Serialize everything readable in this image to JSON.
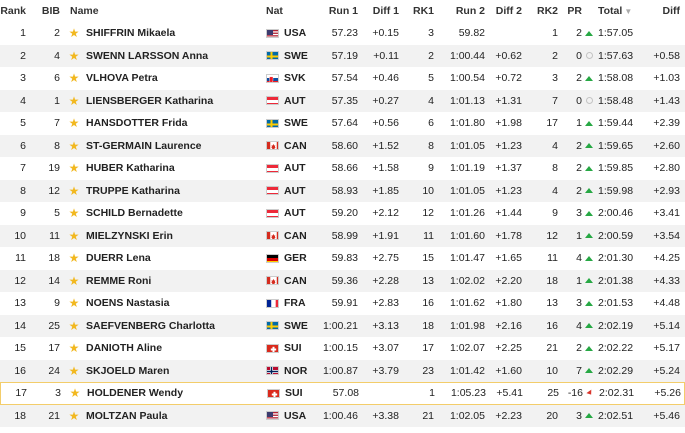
{
  "headers": {
    "rank": "Rank",
    "bib": "BIB",
    "name": "Name",
    "nat": "Nat",
    "run1": "Run 1",
    "diff1": "Diff 1",
    "rk1": "RK1",
    "run2": "Run 2",
    "diff2": "Diff 2",
    "rk2": "RK2",
    "pr": "PR",
    "total": "Total",
    "diff": "Diff"
  },
  "colors": {
    "star": "#f2b81f",
    "arrow_up": "#27a844",
    "arrow_down": "#d9342b",
    "highlight_border": "#f3cd6a"
  },
  "rows": [
    {
      "rank": "1",
      "bib": "2",
      "name": "SHIFFRIN Mikaela",
      "nat": "USA",
      "run1": "57.23",
      "diff1": "+0.15",
      "rk1": "3",
      "run2": "59.82",
      "diff2": "",
      "rk2": "1",
      "pr": "2",
      "trend": "up",
      "total": "1:57.05",
      "diff": ""
    },
    {
      "rank": "2",
      "bib": "4",
      "name": "SWENN LARSSON Anna",
      "nat": "SWE",
      "run1": "57.19",
      "diff1": "+0.11",
      "rk1": "2",
      "run2": "1:00.44",
      "diff2": "+0.62",
      "rk2": "2",
      "pr": "0",
      "trend": "same",
      "total": "1:57.63",
      "diff": "+0.58"
    },
    {
      "rank": "3",
      "bib": "6",
      "name": "VLHOVA Petra",
      "nat": "SVK",
      "run1": "57.54",
      "diff1": "+0.46",
      "rk1": "5",
      "run2": "1:00.54",
      "diff2": "+0.72",
      "rk2": "3",
      "pr": "2",
      "trend": "up",
      "total": "1:58.08",
      "diff": "+1.03"
    },
    {
      "rank": "4",
      "bib": "1",
      "name": "LIENSBERGER Katharina",
      "nat": "AUT",
      "run1": "57.35",
      "diff1": "+0.27",
      "rk1": "4",
      "run2": "1:01.13",
      "diff2": "+1.31",
      "rk2": "7",
      "pr": "0",
      "trend": "same",
      "total": "1:58.48",
      "diff": "+1.43"
    },
    {
      "rank": "5",
      "bib": "7",
      "name": "HANSDOTTER Frida",
      "nat": "SWE",
      "run1": "57.64",
      "diff1": "+0.56",
      "rk1": "6",
      "run2": "1:01.80",
      "diff2": "+1.98",
      "rk2": "17",
      "pr": "1",
      "trend": "up",
      "total": "1:59.44",
      "diff": "+2.39"
    },
    {
      "rank": "6",
      "bib": "8",
      "name": "ST-GERMAIN Laurence",
      "nat": "CAN",
      "run1": "58.60",
      "diff1": "+1.52",
      "rk1": "8",
      "run2": "1:01.05",
      "diff2": "+1.23",
      "rk2": "4",
      "pr": "2",
      "trend": "up",
      "total": "1:59.65",
      "diff": "+2.60"
    },
    {
      "rank": "7",
      "bib": "19",
      "name": "HUBER Katharina",
      "nat": "AUT",
      "run1": "58.66",
      "diff1": "+1.58",
      "rk1": "9",
      "run2": "1:01.19",
      "diff2": "+1.37",
      "rk2": "8",
      "pr": "2",
      "trend": "up",
      "total": "1:59.85",
      "diff": "+2.80"
    },
    {
      "rank": "8",
      "bib": "12",
      "name": "TRUPPE Katharina",
      "nat": "AUT",
      "run1": "58.93",
      "diff1": "+1.85",
      "rk1": "10",
      "run2": "1:01.05",
      "diff2": "+1.23",
      "rk2": "4",
      "pr": "2",
      "trend": "up",
      "total": "1:59.98",
      "diff": "+2.93"
    },
    {
      "rank": "9",
      "bib": "5",
      "name": "SCHILD Bernadette",
      "nat": "AUT",
      "run1": "59.20",
      "diff1": "+2.12",
      "rk1": "12",
      "run2": "1:01.26",
      "diff2": "+1.44",
      "rk2": "9",
      "pr": "3",
      "trend": "up",
      "total": "2:00.46",
      "diff": "+3.41"
    },
    {
      "rank": "10",
      "bib": "11",
      "name": "MIELZYNSKI Erin",
      "nat": "CAN",
      "run1": "58.99",
      "diff1": "+1.91",
      "rk1": "11",
      "run2": "1:01.60",
      "diff2": "+1.78",
      "rk2": "12",
      "pr": "1",
      "trend": "up",
      "total": "2:00.59",
      "diff": "+3.54"
    },
    {
      "rank": "11",
      "bib": "18",
      "name": "DUERR Lena",
      "nat": "GER",
      "run1": "59.83",
      "diff1": "+2.75",
      "rk1": "15",
      "run2": "1:01.47",
      "diff2": "+1.65",
      "rk2": "11",
      "pr": "4",
      "trend": "up",
      "total": "2:01.30",
      "diff": "+4.25"
    },
    {
      "rank": "12",
      "bib": "14",
      "name": "REMME Roni",
      "nat": "CAN",
      "run1": "59.36",
      "diff1": "+2.28",
      "rk1": "13",
      "run2": "1:02.02",
      "diff2": "+2.20",
      "rk2": "18",
      "pr": "1",
      "trend": "up",
      "total": "2:01.38",
      "diff": "+4.33"
    },
    {
      "rank": "13",
      "bib": "9",
      "name": "NOENS Nastasia",
      "nat": "FRA",
      "run1": "59.91",
      "diff1": "+2.83",
      "rk1": "16",
      "run2": "1:01.62",
      "diff2": "+1.80",
      "rk2": "13",
      "pr": "3",
      "trend": "up",
      "total": "2:01.53",
      "diff": "+4.48"
    },
    {
      "rank": "14",
      "bib": "25",
      "name": "SAEFVENBERG Charlotta",
      "nat": "SWE",
      "run1": "1:00.21",
      "diff1": "+3.13",
      "rk1": "18",
      "run2": "1:01.98",
      "diff2": "+2.16",
      "rk2": "16",
      "pr": "4",
      "trend": "up",
      "total": "2:02.19",
      "diff": "+5.14"
    },
    {
      "rank": "15",
      "bib": "17",
      "name": "DANIOTH Aline",
      "nat": "SUI",
      "run1": "1:00.15",
      "diff1": "+3.07",
      "rk1": "17",
      "run2": "1:02.07",
      "diff2": "+2.25",
      "rk2": "21",
      "pr": "2",
      "trend": "up",
      "total": "2:02.22",
      "diff": "+5.17"
    },
    {
      "rank": "16",
      "bib": "24",
      "name": "SKJOELD Maren",
      "nat": "NOR",
      "run1": "1:00.87",
      "diff1": "+3.79",
      "rk1": "23",
      "run2": "1:01.42",
      "diff2": "+1.60",
      "rk2": "10",
      "pr": "7",
      "trend": "up",
      "total": "2:02.29",
      "diff": "+5.24"
    },
    {
      "rank": "17",
      "bib": "3",
      "name": "HOLDENER Wendy",
      "nat": "SUI",
      "run1": "57.08",
      "diff1": "",
      "rk1": "1",
      "run2": "1:05.23",
      "diff2": "+5.41",
      "rk2": "25",
      "pr": "-16",
      "trend": "down",
      "total": "2:02.31",
      "diff": "+5.26"
    },
    {
      "rank": "18",
      "bib": "21",
      "name": "MOLTZAN Paula",
      "nat": "USA",
      "run1": "1:00.46",
      "diff1": "+3.38",
      "rk1": "21",
      "run2": "1:02.05",
      "diff2": "+2.23",
      "rk2": "20",
      "pr": "3",
      "trend": "up",
      "total": "2:02.51",
      "diff": "+5.46"
    }
  ]
}
